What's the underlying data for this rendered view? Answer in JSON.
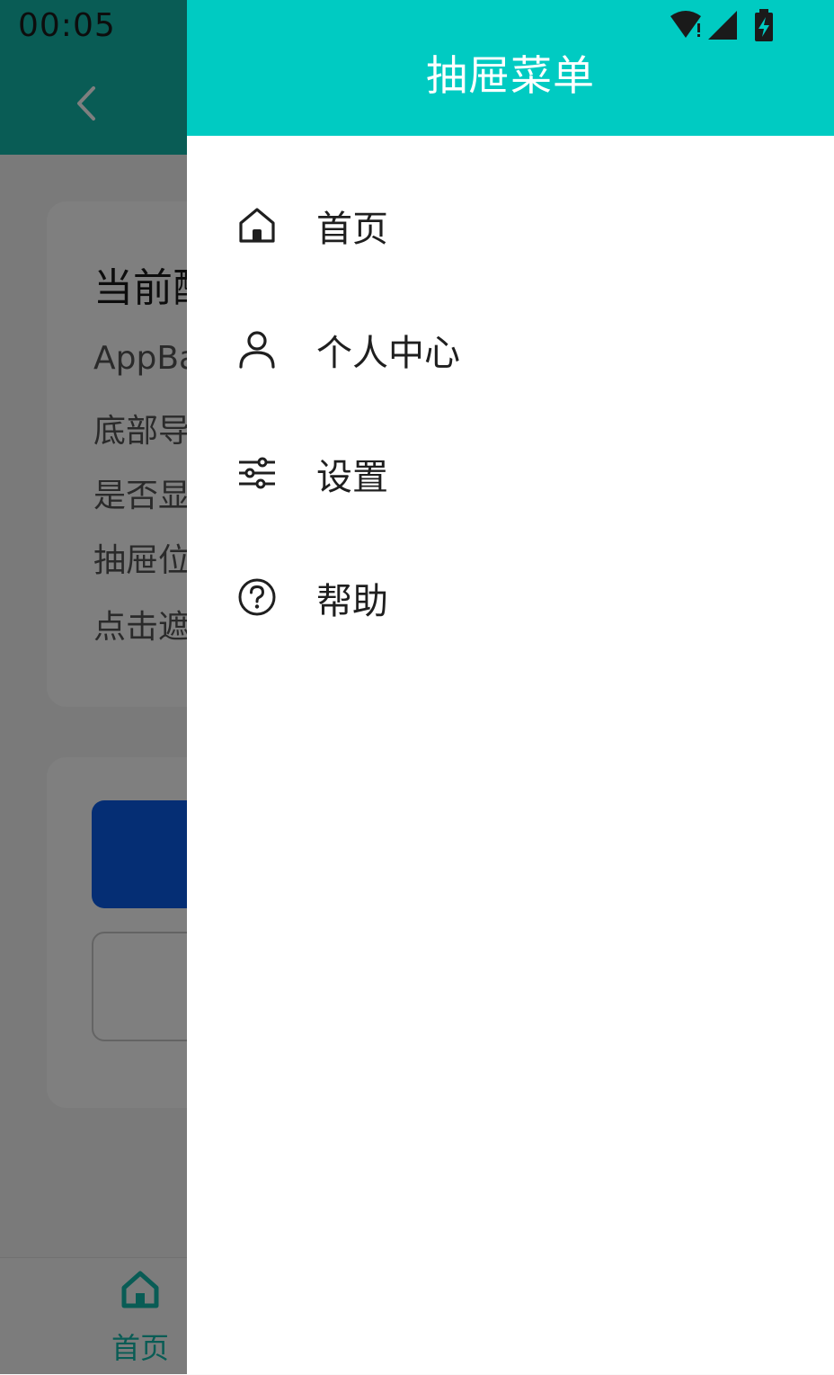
{
  "status_bar": {
    "time": "00:05"
  },
  "background_page": {
    "card_title": "当前配",
    "lines": [
      "AppBa",
      "底部导",
      "是否显",
      "抽屉位",
      "点击遮"
    ],
    "bottom_nav": {
      "label": "首页"
    }
  },
  "drawer": {
    "title": "抽屉菜单",
    "items": [
      {
        "label": "首页",
        "icon": "home-icon"
      },
      {
        "label": "个人中心",
        "icon": "person-icon"
      },
      {
        "label": "设置",
        "icon": "sliders-icon"
      },
      {
        "label": "帮助",
        "icon": "help-circle-icon"
      }
    ]
  },
  "colors": {
    "drawer_header": "#00cbc2",
    "app_bar": "#12b8aa",
    "primary_button": "#0a5de8",
    "nav_active": "#12b8aa"
  }
}
